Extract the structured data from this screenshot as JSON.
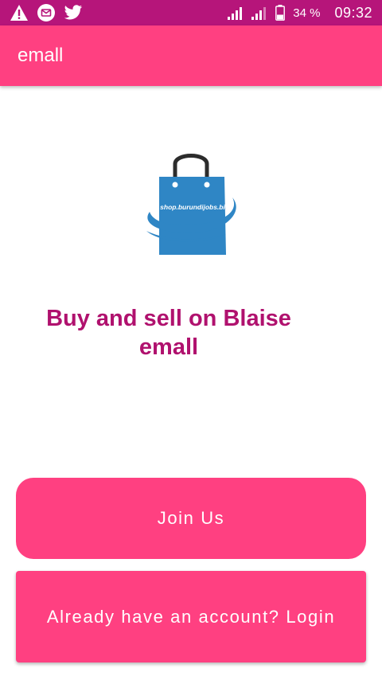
{
  "status_bar": {
    "battery": "34 %",
    "time": "09:32",
    "icons": [
      "warning-icon",
      "email-icon",
      "twitter-icon",
      "signal-icon",
      "signal-icon",
      "battery-icon"
    ]
  },
  "app_bar": {
    "title": "emall"
  },
  "main": {
    "logo_text": "shop.burundijobs.bi",
    "headline": "Buy and sell on Blaise emall"
  },
  "actions": {
    "join_label": "Join Us",
    "login_label": "Already have an account? Login"
  },
  "colors": {
    "status_bar": "#b6157a",
    "app_bar": "#ff4081",
    "button": "#ff4081",
    "headline": "#b0116e",
    "logo_blue": "#2f86c5"
  }
}
